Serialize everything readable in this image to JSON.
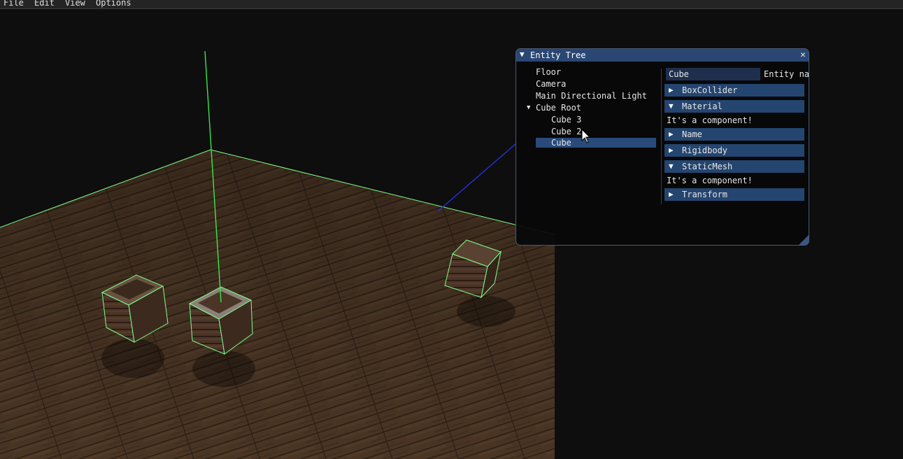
{
  "menu": {
    "file": "File",
    "edit": "Edit",
    "view": "View",
    "options": "Options"
  },
  "entity_window": {
    "title": "Entity Tree",
    "collapse_icon": "triangle-down-icon",
    "close_icon": "close-icon",
    "tree": {
      "floor": "Floor",
      "camera": "Camera",
      "light": "Main Directional Light",
      "cube_root": "Cube Root",
      "cube3": "Cube 3",
      "cube2": "Cube 2",
      "cube": "Cube"
    },
    "inspector": {
      "name_value": "Cube",
      "name_label": "Entity na",
      "components": {
        "boxcollider": "BoxCollider",
        "material": "Material",
        "material_text": "It's a component!",
        "name": "Name",
        "rigidbody": "Rigidbody",
        "staticmesh": "StaticMesh",
        "staticmesh_text": "It's a component!",
        "transform": "Transform"
      }
    }
  },
  "colors": {
    "title_bar": "#2a4773",
    "header": "#24456f",
    "selection": "#294a7a",
    "selection_outline": "#7dff8a"
  }
}
